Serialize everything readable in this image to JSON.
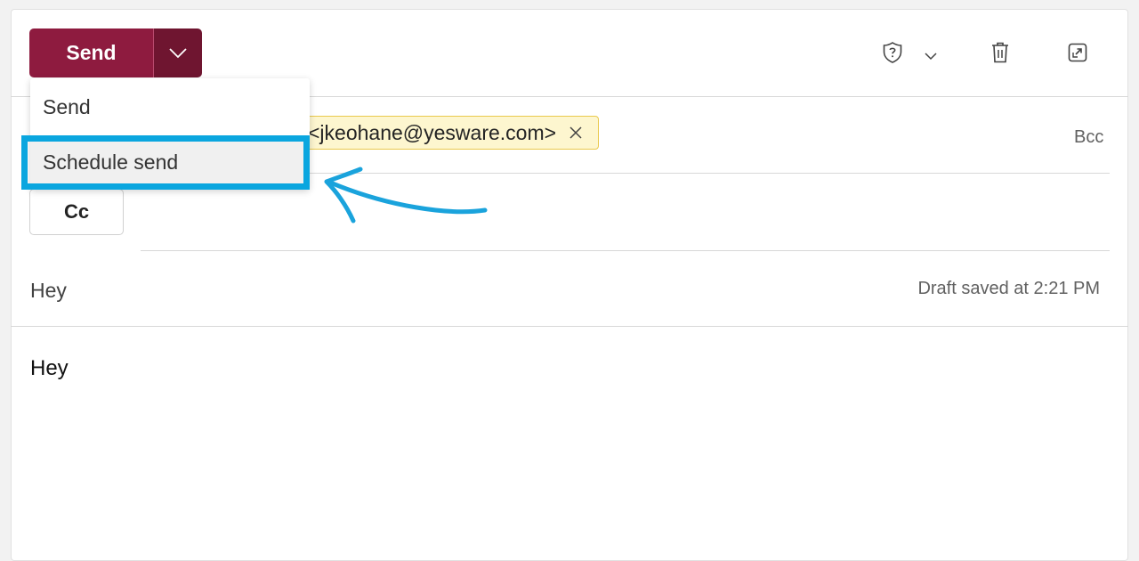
{
  "toolbar": {
    "send_label": "Send",
    "icons": [
      "send-options-chevron-icon",
      "shield-question-icon",
      "chevron-down-icon",
      "trash-icon",
      "pop-out-icon"
    ]
  },
  "send_menu": {
    "items": [
      {
        "label": "Send"
      },
      {
        "label": "Schedule send"
      }
    ]
  },
  "compose": {
    "recipient_chip": "<jkeohane@yesware.com>",
    "bcc_label": "Bcc",
    "cc_label": "Cc",
    "subject": "Hey",
    "draft_status": "Draft saved at 2:21 PM",
    "body": "Hey"
  },
  "colors": {
    "send_button": "#8e1b3f",
    "send_split": "#6f1530",
    "highlight": "#0aa6df",
    "chip_background": "#fdf6cf"
  }
}
